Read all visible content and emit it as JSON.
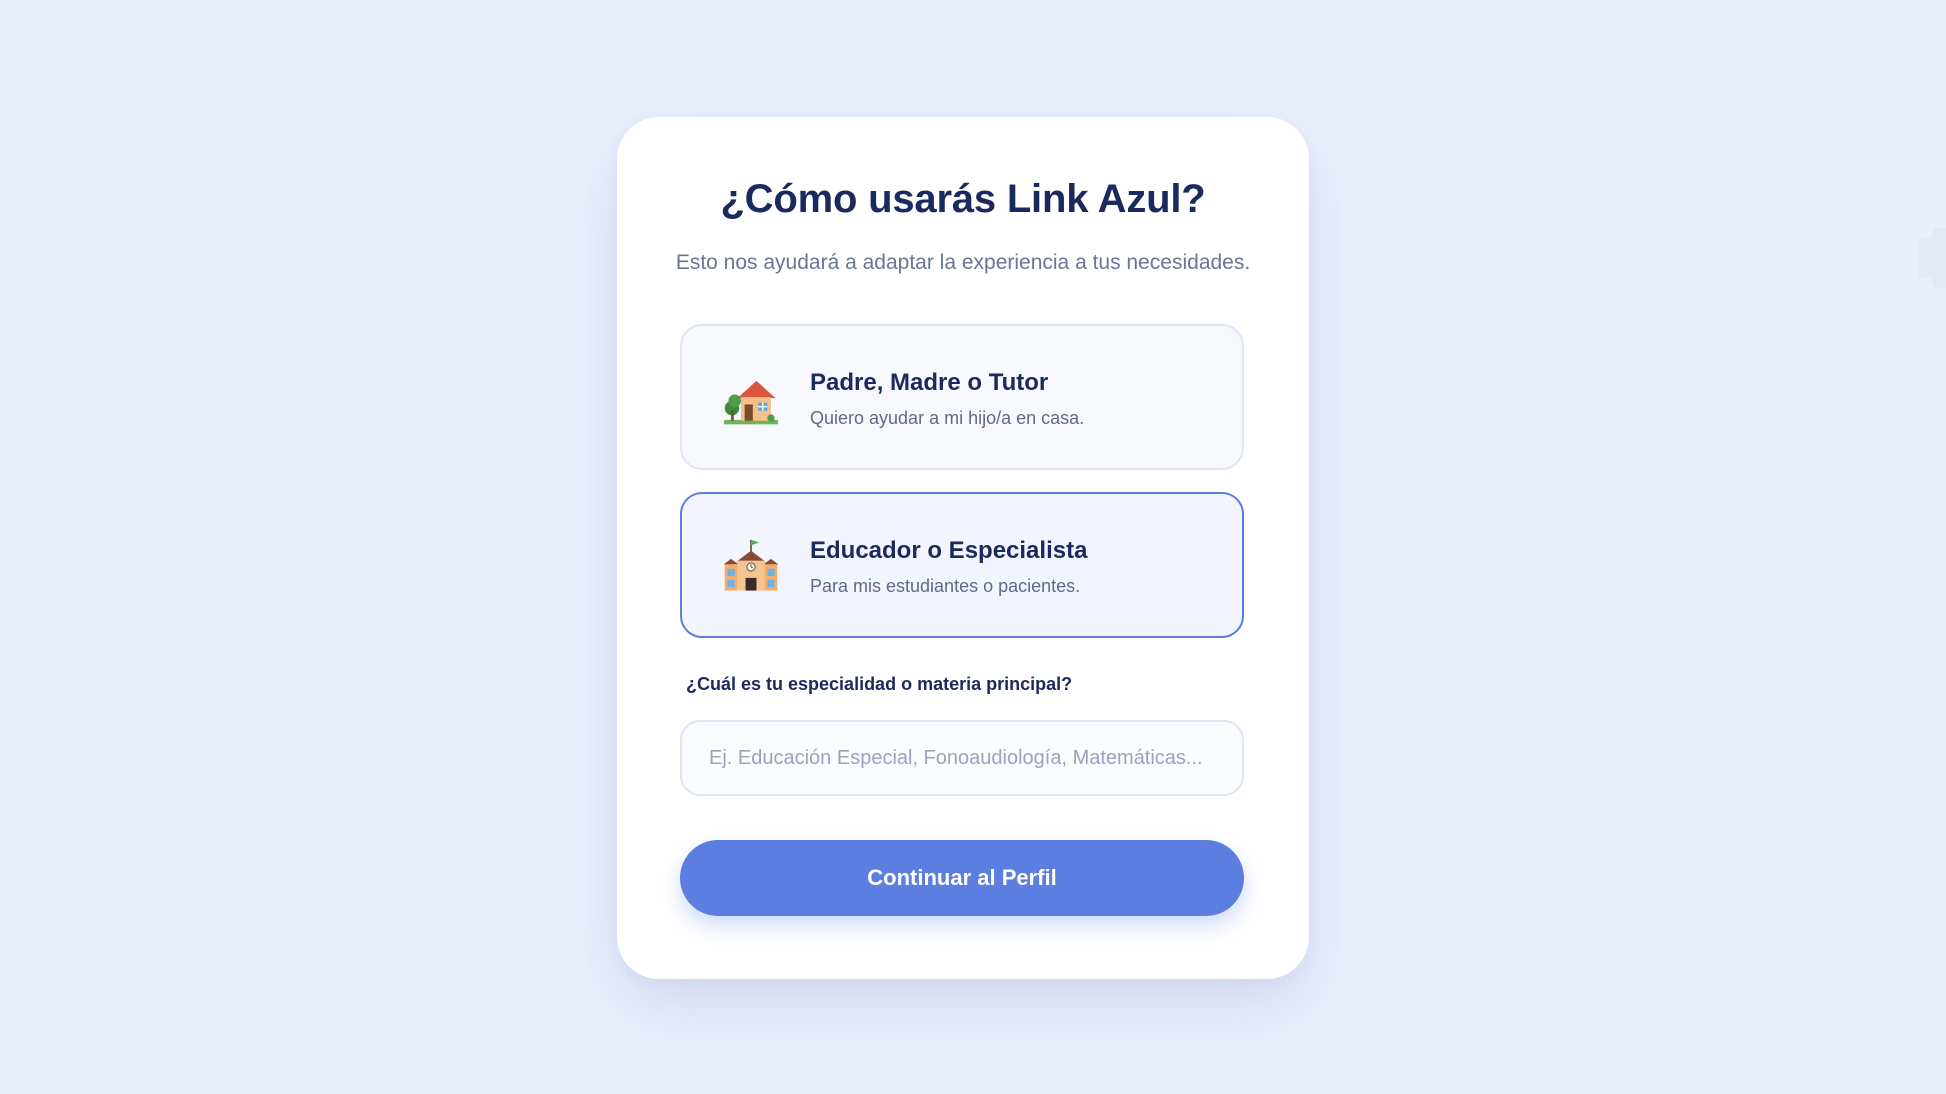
{
  "onboarding": {
    "title": "¿Cómo usarás Link Azul?",
    "subtitle": "Esto nos ayudará a adaptar la experiencia a tus necesidades.",
    "options": [
      {
        "title": "Padre, Madre o Tutor",
        "description": "Quiero ayudar a mi hijo/a en casa.",
        "icon": "house-icon",
        "selected": false
      },
      {
        "title": "Educador o Especialista",
        "description": "Para mis estudiantes o pacientes.",
        "icon": "school-icon",
        "selected": true
      }
    ],
    "specialty": {
      "label": "¿Cuál es tu especialidad o materia principal?",
      "placeholder": "Ej. Educación Especial, Fonoaudiología, Matemáticas...",
      "value": ""
    },
    "continue_label": "Continuar al Perfil"
  },
  "colors": {
    "background": "#eaeefd",
    "card": "#ffffff",
    "primary": "#5b7ee0",
    "heading": "#1b2a5e",
    "muted": "#6a7595"
  }
}
